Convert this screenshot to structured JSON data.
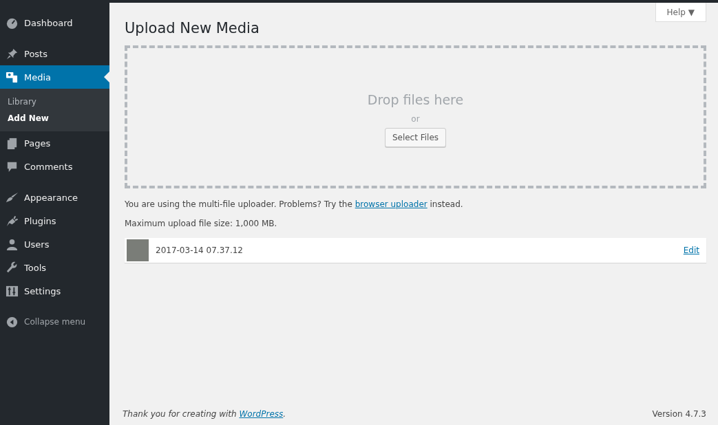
{
  "sidebar": {
    "groups": [
      {
        "items": [
          {
            "label": "Dashboard",
            "kind": "gauge",
            "selected": false
          }
        ]
      },
      {
        "items": [
          {
            "label": "Posts",
            "kind": "pin",
            "selected": false
          },
          {
            "label": "Media",
            "kind": "media",
            "selected": true,
            "submenu": [
              {
                "label": "Library",
                "selected": false
              },
              {
                "label": "Add New",
                "selected": true
              }
            ]
          },
          {
            "label": "Pages",
            "kind": "pages",
            "selected": false
          },
          {
            "label": "Comments",
            "kind": "comment",
            "selected": false
          }
        ]
      },
      {
        "items": [
          {
            "label": "Appearance",
            "kind": "brush",
            "selected": false
          },
          {
            "label": "Plugins",
            "kind": "plug",
            "selected": false
          },
          {
            "label": "Users",
            "kind": "user",
            "selected": false
          },
          {
            "label": "Tools",
            "kind": "wrench",
            "selected": false
          },
          {
            "label": "Settings",
            "kind": "sliders",
            "selected": false
          }
        ]
      }
    ],
    "collapse": "Collapse menu"
  },
  "help_button": "Help ▼",
  "title": "Upload New Media",
  "dropzone": {
    "heading": "Drop files here",
    "or": "or",
    "button": "Select Files"
  },
  "uploader_note": {
    "before": "You are using the multi-file uploader. Problems? Try the ",
    "link": "browser uploader",
    "after": " instead."
  },
  "max_size": "Maximum upload file size: 1,000 MB.",
  "uploads": [
    {
      "name": "2017-03-14 07.37.12",
      "action": "Edit"
    }
  ],
  "footer": {
    "before": "Thank you for creating with ",
    "link": "WordPress",
    "after": ".",
    "version": "Version 4.7.3"
  }
}
